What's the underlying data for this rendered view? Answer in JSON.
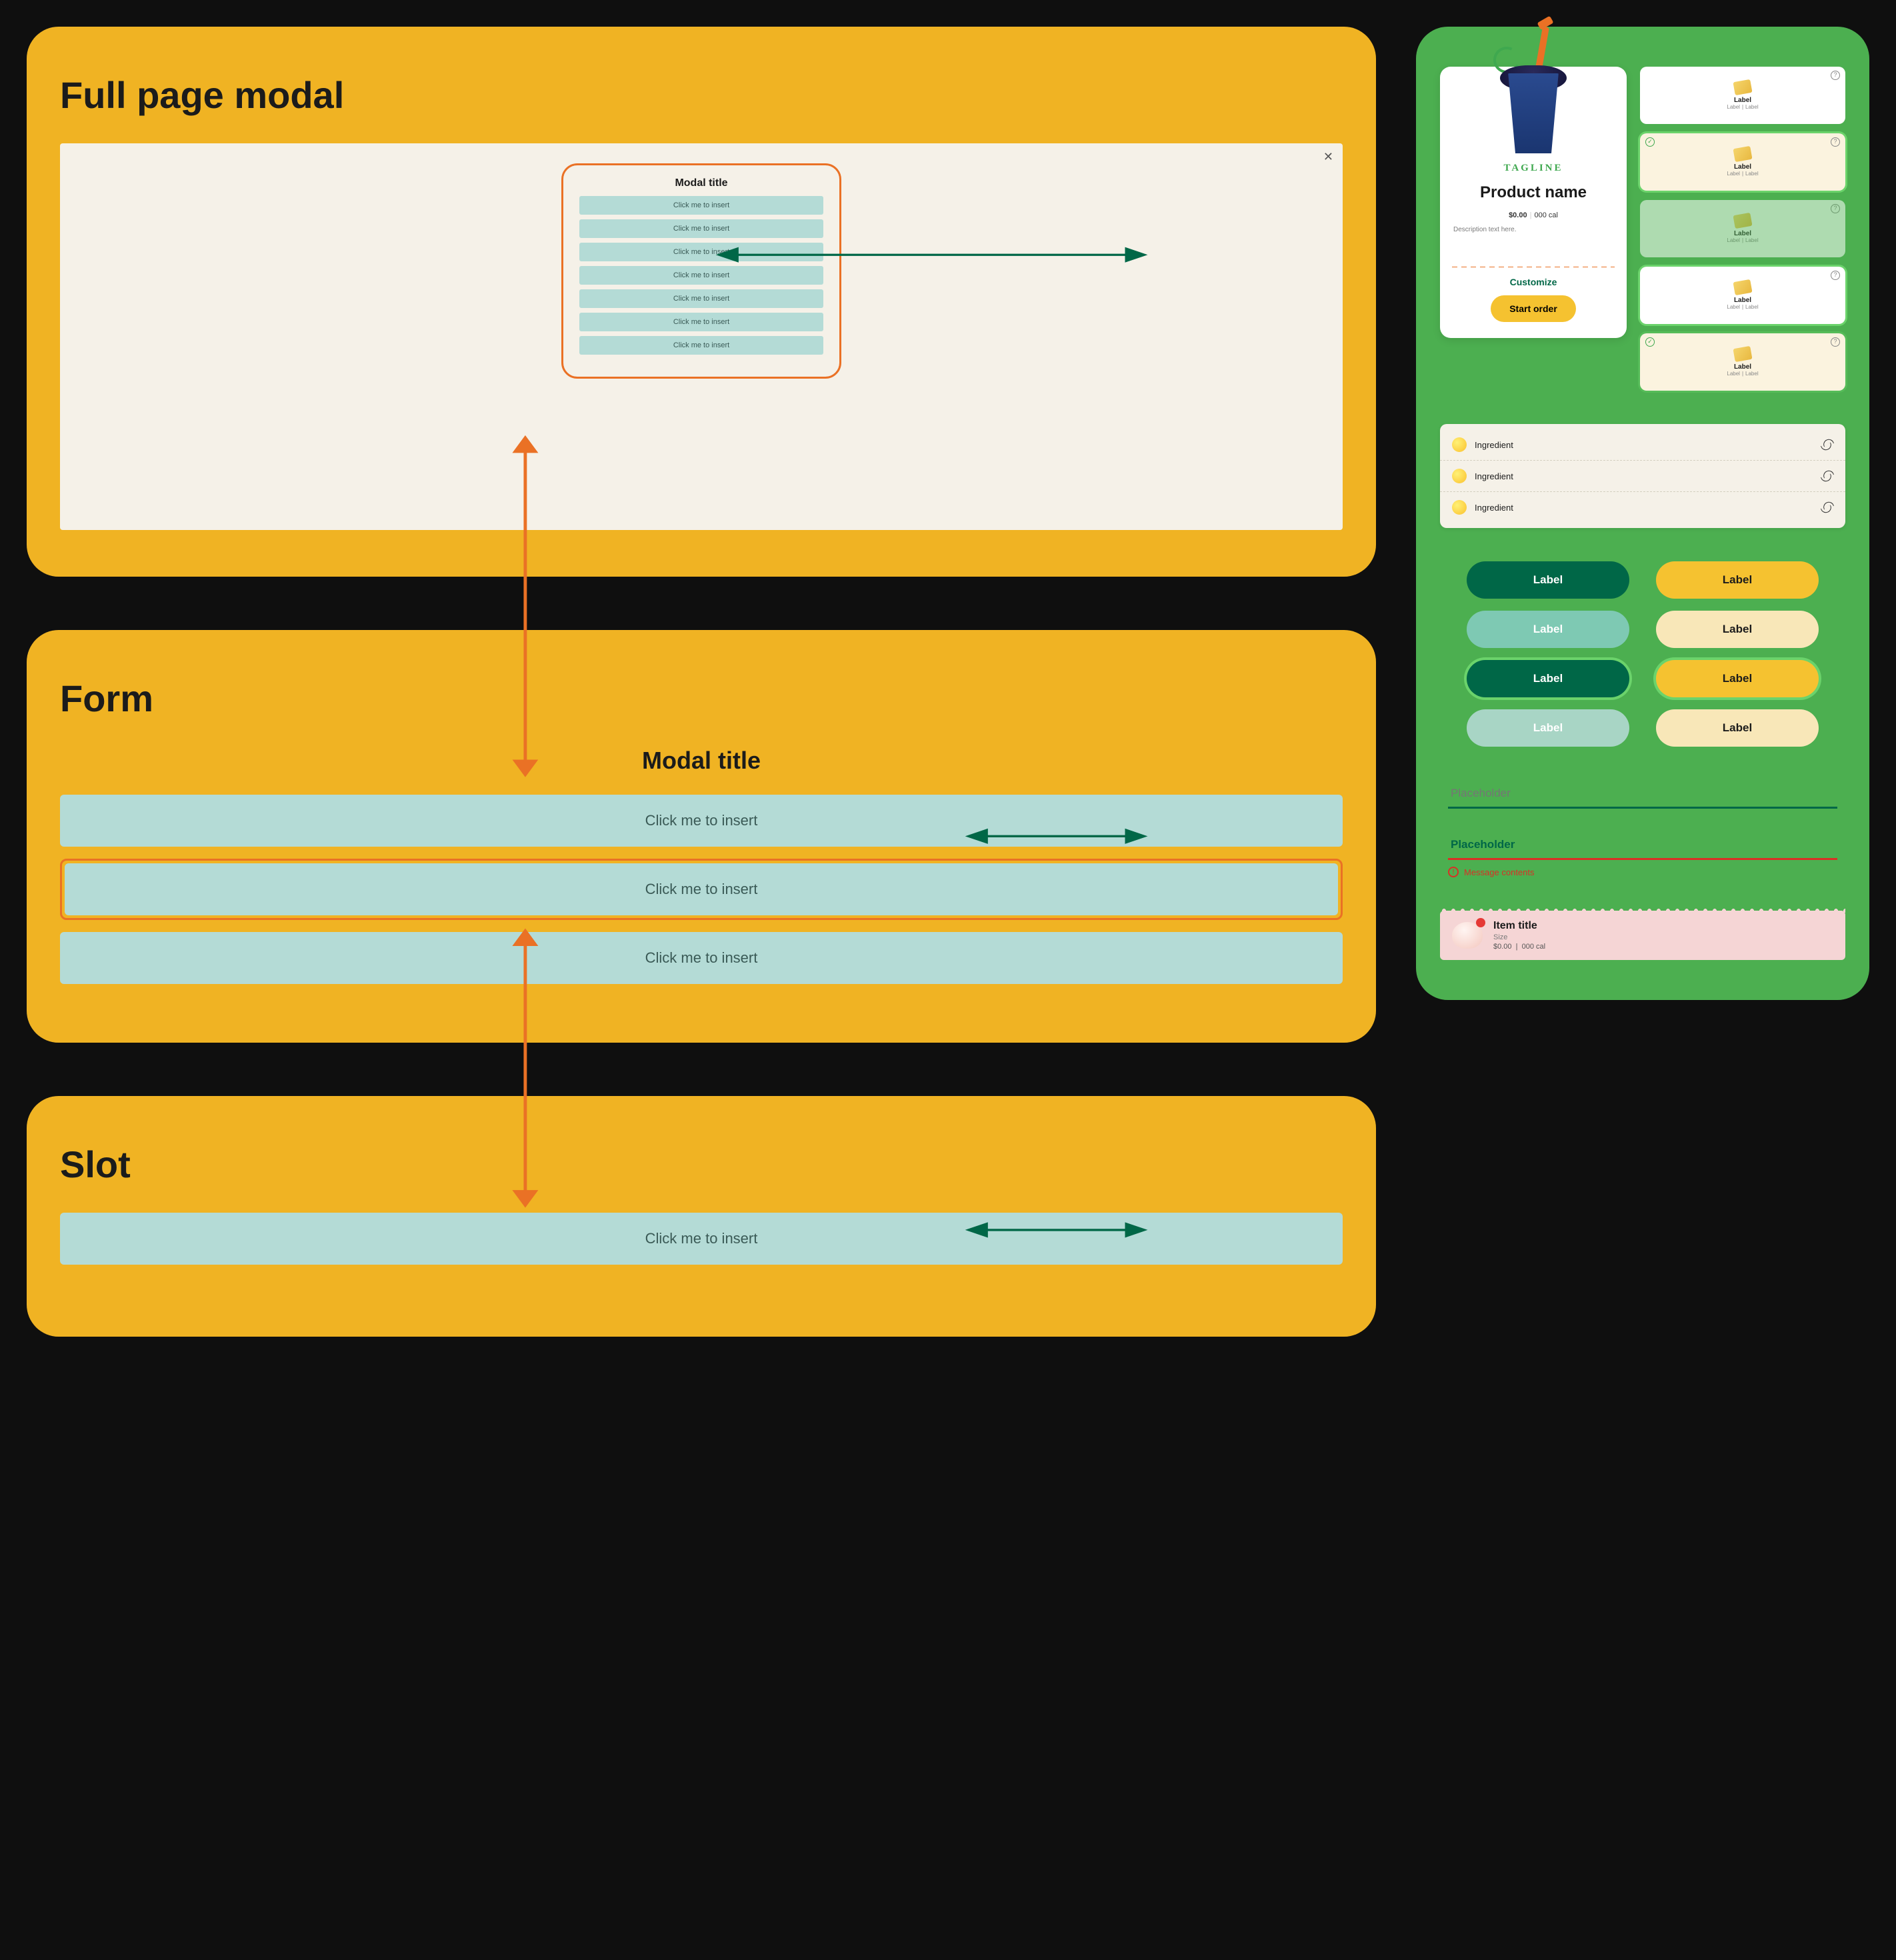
{
  "left": {
    "modalSection": {
      "heading": "Full page modal",
      "modal": {
        "title": "Modal title",
        "slotLabel": "Click me to insert",
        "slotCount": 7
      }
    },
    "formSection": {
      "heading": "Form",
      "title": "Modal title",
      "slots": [
        "Click me to insert",
        "Click me to insert",
        "Click me to insert"
      ]
    },
    "slotSection": {
      "heading": "Slot",
      "slot": "Click me to insert"
    }
  },
  "right": {
    "product": {
      "tagline": "TAGLINE",
      "name": "Product name",
      "price": "$0.00",
      "cal": "000 cal",
      "description": "Description text here.",
      "customize": "Customize",
      "cta": "Start order"
    },
    "miniCards": [
      {
        "label": "Label",
        "sub1": "Label",
        "sub2": "Label",
        "tint": false,
        "check": false,
        "dim": false,
        "ring": false
      },
      {
        "label": "Label",
        "sub1": "Label",
        "sub2": "Label",
        "tint": true,
        "check": true,
        "dim": false,
        "ring": true
      },
      {
        "label": "Label",
        "sub1": "Label",
        "sub2": "Label",
        "tint": false,
        "check": false,
        "dim": true,
        "ring": false
      },
      {
        "label": "Label",
        "sub1": "Label",
        "sub2": "Label",
        "tint": false,
        "check": false,
        "dim": false,
        "ring": true
      },
      {
        "label": "Label",
        "sub1": "Label",
        "sub2": "Label",
        "tint": true,
        "check": true,
        "dim": false,
        "ring2": true
      }
    ],
    "ingredients": [
      "Ingredient",
      "Ingredient",
      "Ingredient"
    ],
    "buttons": [
      {
        "label": "Label",
        "cls": "dg"
      },
      {
        "label": "Label",
        "cls": "by"
      },
      {
        "label": "Label",
        "cls": "mg"
      },
      {
        "label": "Label",
        "cls": "py"
      },
      {
        "label": "Label",
        "cls": "dg ring"
      },
      {
        "label": "Label",
        "cls": "by ring"
      },
      {
        "label": "Label",
        "cls": "lg"
      },
      {
        "label": "Label",
        "cls": "cream"
      }
    ],
    "inputs": {
      "ok": "Placeholder",
      "err": "Placeholder",
      "errorMsg": "Message contents"
    },
    "item": {
      "title": "Item title",
      "size": "Size",
      "price": "$0.00",
      "cal": "000 cal"
    }
  }
}
